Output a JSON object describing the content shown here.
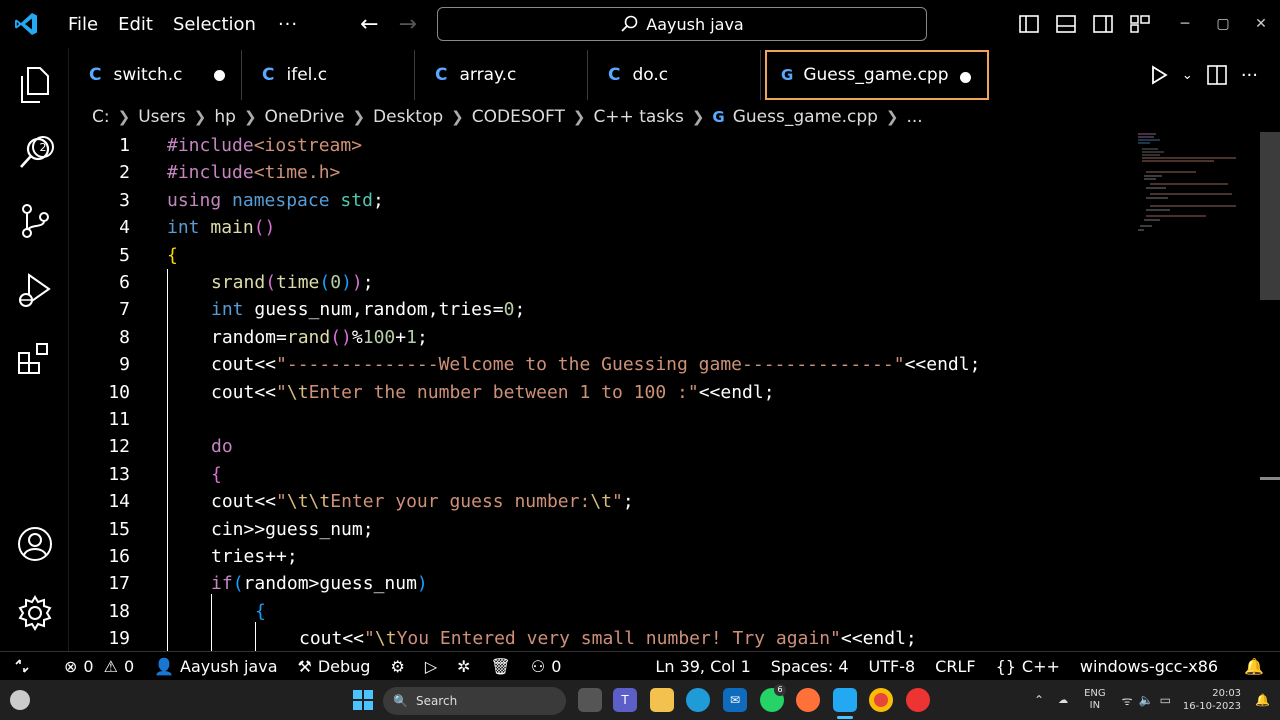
{
  "menu": [
    "File",
    "Edit",
    "Selection",
    "···"
  ],
  "search": {
    "text": "Aayush java"
  },
  "tabs": [
    {
      "label": "switch.c",
      "icon": "C",
      "dirty": true,
      "width": 173
    },
    {
      "label": "ifel.c",
      "icon": "C",
      "dirty": false,
      "width": 173
    },
    {
      "label": "array.c",
      "icon": "C",
      "dirty": false,
      "width": 173
    },
    {
      "label": "do.c",
      "icon": "C",
      "dirty": false,
      "width": 173
    },
    {
      "label": "Guess_game.cpp",
      "icon": "G",
      "dirty": true,
      "active": true,
      "width": 224
    }
  ],
  "breadcrumb": [
    "C:",
    "Users",
    "hp",
    "OneDrive",
    "Desktop",
    "CODESOFT",
    "C++ tasks",
    "Guess_game.cpp",
    "..."
  ],
  "activity_badge": "2",
  "code_lines": [
    {
      "n": "1",
      "indent": 0,
      "tokens": [
        [
          "#include",
          "#c586c0"
        ],
        [
          "<iostream>",
          "#ce9178"
        ]
      ]
    },
    {
      "n": "2",
      "indent": 0,
      "tokens": [
        [
          "#include",
          "#c586c0"
        ],
        [
          "<time.h>",
          "#ce9178"
        ]
      ]
    },
    {
      "n": "3",
      "indent": 0,
      "tokens": [
        [
          "using",
          "#c586c0"
        ],
        [
          " ",
          "#fff"
        ],
        [
          "namespace",
          "#569cd6"
        ],
        [
          " ",
          "#fff"
        ],
        [
          "std",
          "#4ec9b0"
        ],
        [
          ";",
          "#fff"
        ]
      ]
    },
    {
      "n": "4",
      "indent": 0,
      "tokens": [
        [
          "int",
          "#569cd6"
        ],
        [
          " ",
          "#fff"
        ],
        [
          "main",
          "#dcdcaa"
        ],
        [
          "()",
          "#da70d6"
        ]
      ]
    },
    {
      "n": "5",
      "indent": 0,
      "tokens": [
        [
          "{",
          "#ffd700"
        ]
      ]
    },
    {
      "n": "6",
      "indent": 1,
      "tokens": [
        [
          "srand",
          "#dcdcaa"
        ],
        [
          "(",
          "#da70d6"
        ],
        [
          "time",
          "#dcdcaa"
        ],
        [
          "(",
          "#179fff"
        ],
        [
          "0",
          "#b5cea8"
        ],
        [
          ")",
          "#179fff"
        ],
        [
          ")",
          "#da70d6"
        ],
        [
          ";",
          "#fff"
        ]
      ]
    },
    {
      "n": "7",
      "indent": 1,
      "tokens": [
        [
          "int",
          "#569cd6"
        ],
        [
          " guess_num,random,tries=",
          "#fff"
        ],
        [
          "0",
          "#b5cea8"
        ],
        [
          ";",
          "#fff"
        ]
      ]
    },
    {
      "n": "8",
      "indent": 1,
      "tokens": [
        [
          "random=",
          "#fff"
        ],
        [
          "rand",
          "#dcdcaa"
        ],
        [
          "()",
          "#da70d6"
        ],
        [
          "%",
          "#fff"
        ],
        [
          "100",
          "#b5cea8"
        ],
        [
          "+",
          "#fff"
        ],
        [
          "1",
          "#b5cea8"
        ],
        [
          ";",
          "#fff"
        ]
      ]
    },
    {
      "n": "9",
      "indent": 1,
      "tokens": [
        [
          "cout<<",
          "#fff"
        ],
        [
          "\"--------------Welcome to the Guessing game--------------\"",
          "#ce9178"
        ],
        [
          "<<endl;",
          "#fff"
        ]
      ]
    },
    {
      "n": "10",
      "indent": 1,
      "tokens": [
        [
          "cout<<",
          "#fff"
        ],
        [
          "\"",
          "#ce9178"
        ],
        [
          "\\t",
          "#d7ba7d"
        ],
        [
          "Enter the number between 1 to 100 :\"",
          "#ce9178"
        ],
        [
          "<<endl;",
          "#fff"
        ]
      ]
    },
    {
      "n": "11",
      "indent": 1,
      "tokens": []
    },
    {
      "n": "12",
      "indent": 1,
      "tokens": [
        [
          "do",
          "#c586c0"
        ]
      ]
    },
    {
      "n": "13",
      "indent": 1,
      "tokens": [
        [
          "{",
          "#da70d6"
        ]
      ]
    },
    {
      "n": "14",
      "indent": 1,
      "tokens": [
        [
          "cout<<",
          "#fff"
        ],
        [
          "\"",
          "#ce9178"
        ],
        [
          "\\t\\t",
          "#d7ba7d"
        ],
        [
          "Enter your guess number:",
          "#ce9178"
        ],
        [
          "\\t",
          "#d7ba7d"
        ],
        [
          "\"",
          "#ce9178"
        ],
        [
          ";",
          "#fff"
        ]
      ]
    },
    {
      "n": "15",
      "indent": 1,
      "tokens": [
        [
          "cin>>guess_num;",
          "#fff"
        ]
      ]
    },
    {
      "n": "16",
      "indent": 1,
      "tokens": [
        [
          "tries++;",
          "#fff"
        ]
      ]
    },
    {
      "n": "17",
      "indent": 1,
      "tokens": [
        [
          "if",
          "#c586c0"
        ],
        [
          "(",
          "#179fff"
        ],
        [
          "random>guess_num",
          "#fff"
        ],
        [
          ")",
          "#179fff"
        ]
      ]
    },
    {
      "n": "18",
      "indent": 2,
      "tokens": [
        [
          "{",
          "#179fff"
        ]
      ]
    },
    {
      "n": "19",
      "indent": 3,
      "tokens": [
        [
          "cout<<",
          "#fff"
        ],
        [
          "\"",
          "#ce9178"
        ],
        [
          "\\t",
          "#d7ba7d"
        ],
        [
          "You Entered very small number! Try again\"",
          "#ce9178"
        ],
        [
          "<<endl;",
          "#fff"
        ]
      ]
    }
  ],
  "status": {
    "errors": "0",
    "warnings": "0",
    "profile": "Aayush java",
    "debug": "Debug",
    "ports": "0",
    "position": "Ln 39, Col 1",
    "spaces": "Spaces: 4",
    "encoding": "UTF-8",
    "eol": "CRLF",
    "language": "C++",
    "compiler": "windows-gcc-x86"
  },
  "taskbar": {
    "search_placeholder": "Search",
    "lang_top": "ENG",
    "lang_bottom": "IN",
    "time": "20:03",
    "date": "16-10-2023",
    "whatsapp_badge": "6"
  },
  "colors": {
    "accent_tab": "#f0a35b",
    "vscode_blue": "#23a9f2"
  }
}
